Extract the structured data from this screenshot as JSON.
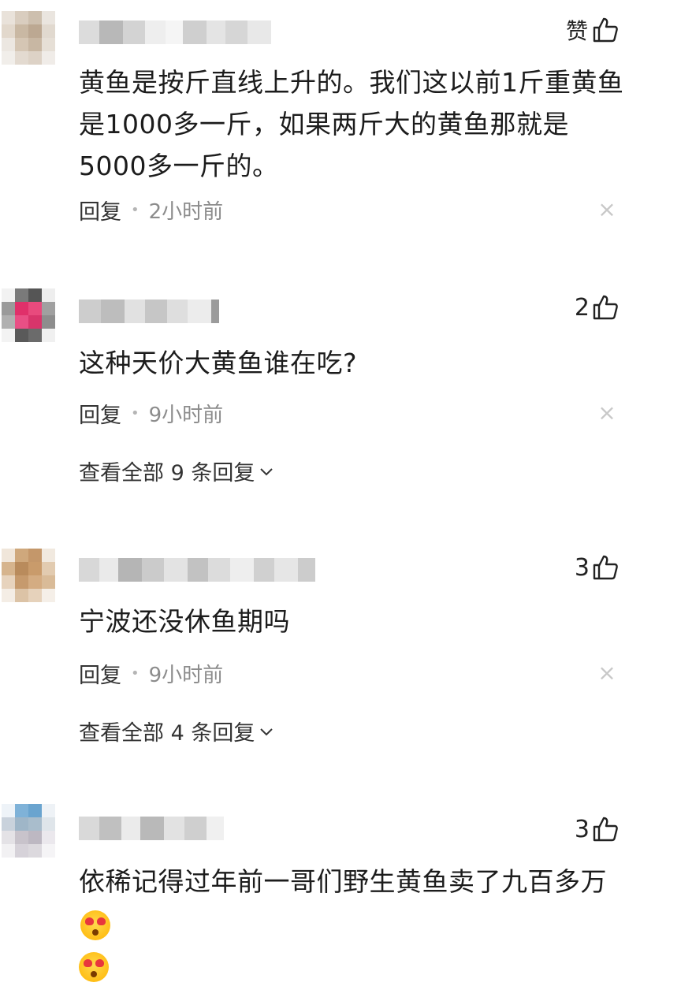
{
  "comments": [
    {
      "like_label": "赞",
      "like_count": "",
      "text": "黄鱼是按斤直线上升的。我们这以前1斤重黄鱼是1000多一斤，如果两斤大的黄鱼那就是5000多一斤的。",
      "reply_label": "回复",
      "time": "2小时前"
    },
    {
      "like_label": "",
      "like_count": "2",
      "text": "这种天价大黄鱼谁在吃?",
      "reply_label": "回复",
      "time": "9小时前",
      "more_replies": "查看全部 9 条回复"
    },
    {
      "like_label": "",
      "like_count": "3",
      "text": "宁波还没休鱼期吗",
      "reply_label": "回复",
      "time": "9小时前",
      "more_replies": "查看全部 4 条回复"
    },
    {
      "like_label": "",
      "like_count": "3",
      "text": "依稀记得过年前一哥们野生黄鱼卖了九百多万"
    }
  ],
  "icons": {
    "like": "thumbs-up-icon",
    "close": "close-icon",
    "expand": "chevron-down-icon",
    "emoji": "heart-eyes-emoji-icon"
  }
}
